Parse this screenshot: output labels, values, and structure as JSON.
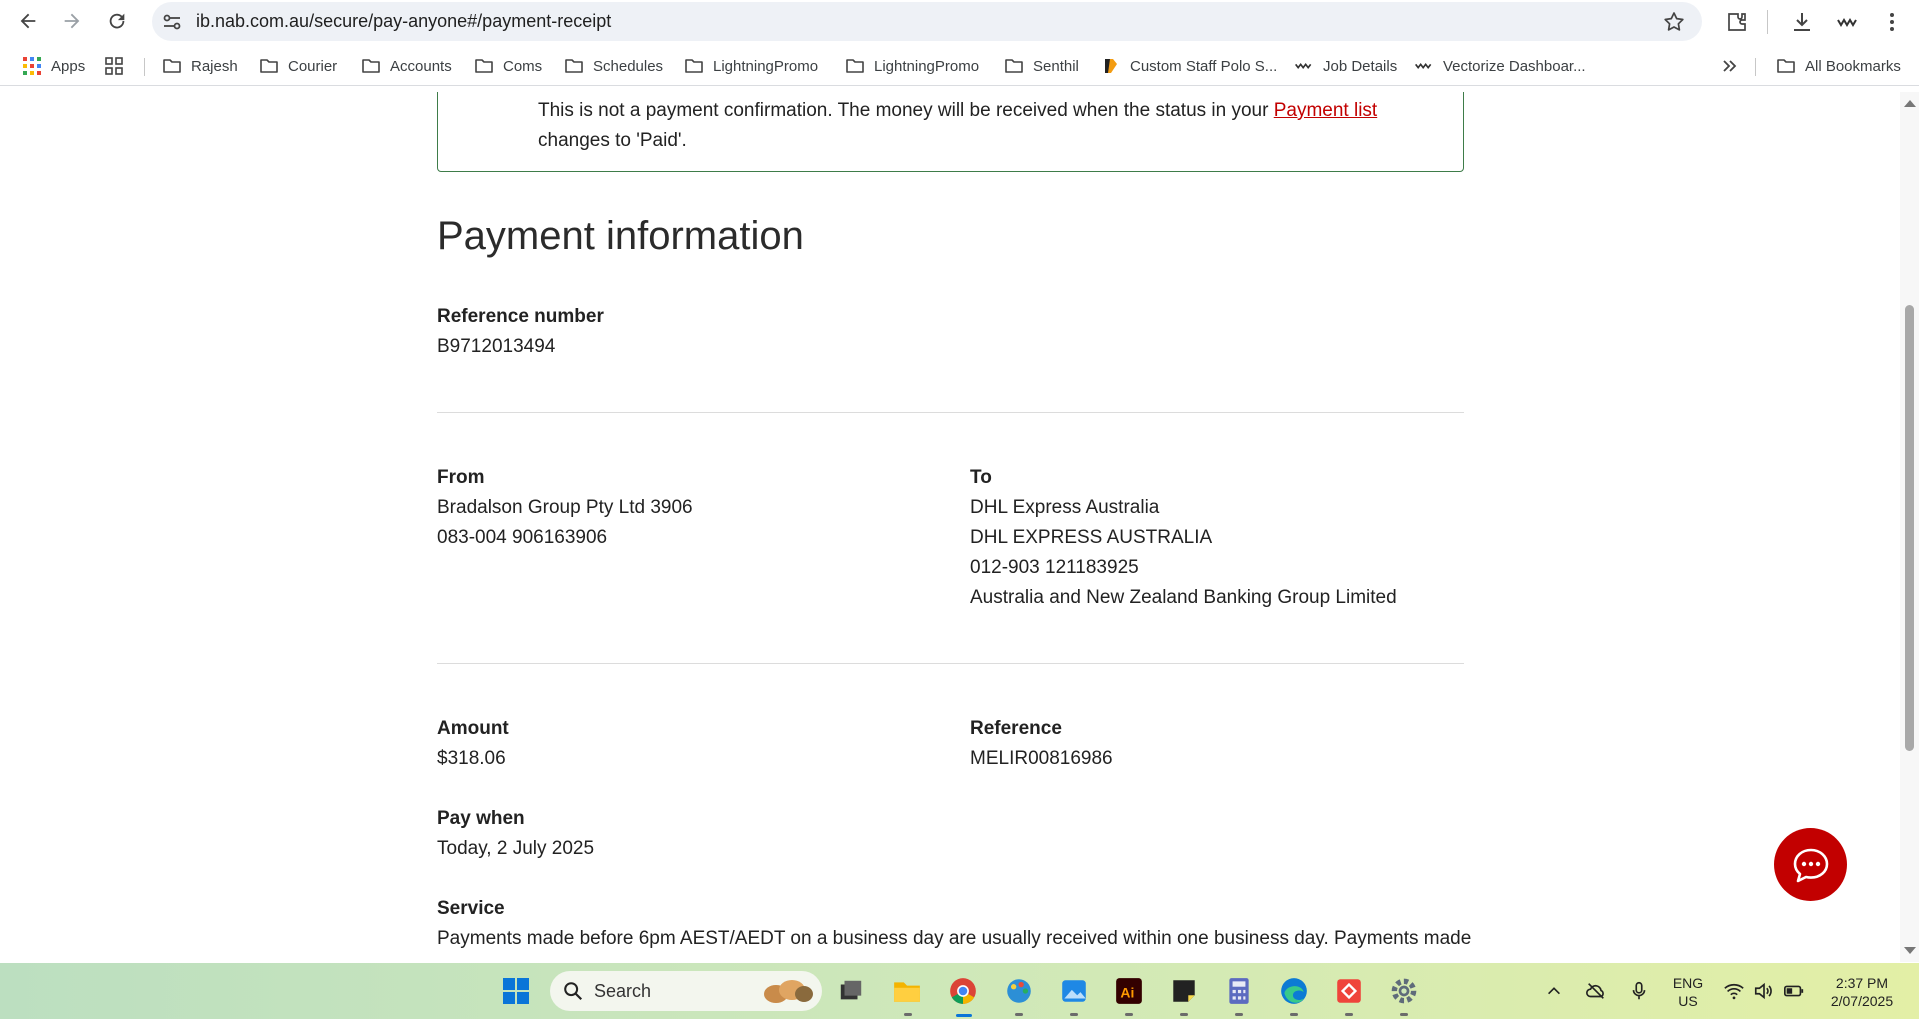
{
  "browser": {
    "url": "ib.nab.com.au/secure/pay-anyone#/payment-receipt",
    "bookmarks": [
      "Apps",
      "Rajesh",
      "Courier",
      "Accounts",
      "Coms",
      "Schedules",
      "LightningPromo",
      "LightningPromo",
      "Senthil",
      "Custom Staff Polo S...",
      "Job Details",
      "Vectorize Dashboar..."
    ],
    "all_bookmarks": "All Bookmarks"
  },
  "notice": {
    "text_before": "This is not a payment confirmation. The money will be received when the status in your ",
    "link": "Payment list",
    "text_after": " changes to 'Paid'."
  },
  "payment": {
    "title": "Payment information",
    "reference_number_label": "Reference number",
    "reference_number": "B9712013494",
    "from_label": "From",
    "from_name": "Bradalson Group Pty Ltd 3906",
    "from_account": "083-004 906163906",
    "to_label": "To",
    "to_name": "DHL Express Australia",
    "to_name2": "DHL EXPRESS AUSTRALIA",
    "to_account": "012-903 121183925",
    "to_bank": "Australia and New Zealand Banking Group Limited",
    "amount_label": "Amount",
    "amount": "$318.06",
    "reference_label": "Reference",
    "reference": "MELIR00816986",
    "pay_when_label": "Pay when",
    "pay_when": "Today, 2 July 2025",
    "service_label": "Service",
    "service_text": "Payments made before 6pm AEST/AEDT on a business day are usually received within one business day. Payments made"
  },
  "taskbar": {
    "search": "Search",
    "lang1": "ENG",
    "lang2": "US",
    "time": "2:37 PM",
    "date": "2/07/2025"
  },
  "colors": {
    "nab_red": "#c20000",
    "notice_border": "#3e7c49"
  }
}
